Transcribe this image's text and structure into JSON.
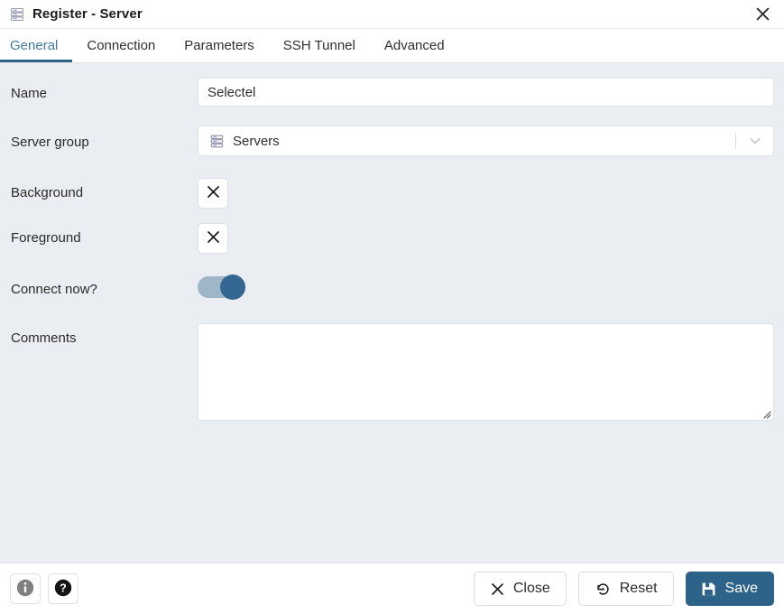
{
  "window": {
    "title": "Register - Server",
    "icon": "server-stack-icon",
    "close_label": "✕"
  },
  "tabs": [
    {
      "label": "General",
      "active": true
    },
    {
      "label": "Connection",
      "active": false
    },
    {
      "label": "Parameters",
      "active": false
    },
    {
      "label": "SSH Tunnel",
      "active": false
    },
    {
      "label": "Advanced",
      "active": false
    }
  ],
  "form": {
    "name": {
      "label": "Name",
      "value": "Selectel",
      "placeholder": ""
    },
    "server_group": {
      "label": "Server group",
      "value": "Servers",
      "icon": "server-group-icon",
      "chevron": "chevron-down-icon"
    },
    "background": {
      "label": "Background",
      "button_icon": "clear-color-x-icon"
    },
    "foreground": {
      "label": "Foreground",
      "button_icon": "clear-color-x-icon"
    },
    "connect_now": {
      "label": "Connect now?",
      "checked": true,
      "track_color": "#9fb5c8",
      "knob_color": "#336791"
    },
    "comments": {
      "label": "Comments",
      "value": "",
      "placeholder": ""
    }
  },
  "footer": {
    "info_button": {
      "icon": "info-icon",
      "color": "#808080"
    },
    "help_button": {
      "icon": "help-question-icon",
      "color": "#141414"
    },
    "close_button": {
      "label": "Close",
      "icon": "close-x-icon"
    },
    "reset_button": {
      "label": "Reset",
      "icon": "reset-undo-icon"
    },
    "save_button": {
      "label": "Save",
      "icon": "save-floppy-icon",
      "color": "#2d6389"
    }
  },
  "theme": {
    "form_background": "#eaedf1",
    "panel_background": "#ffffff",
    "accent": "#2d6389",
    "active_tab_text": "#3f7ba5"
  }
}
